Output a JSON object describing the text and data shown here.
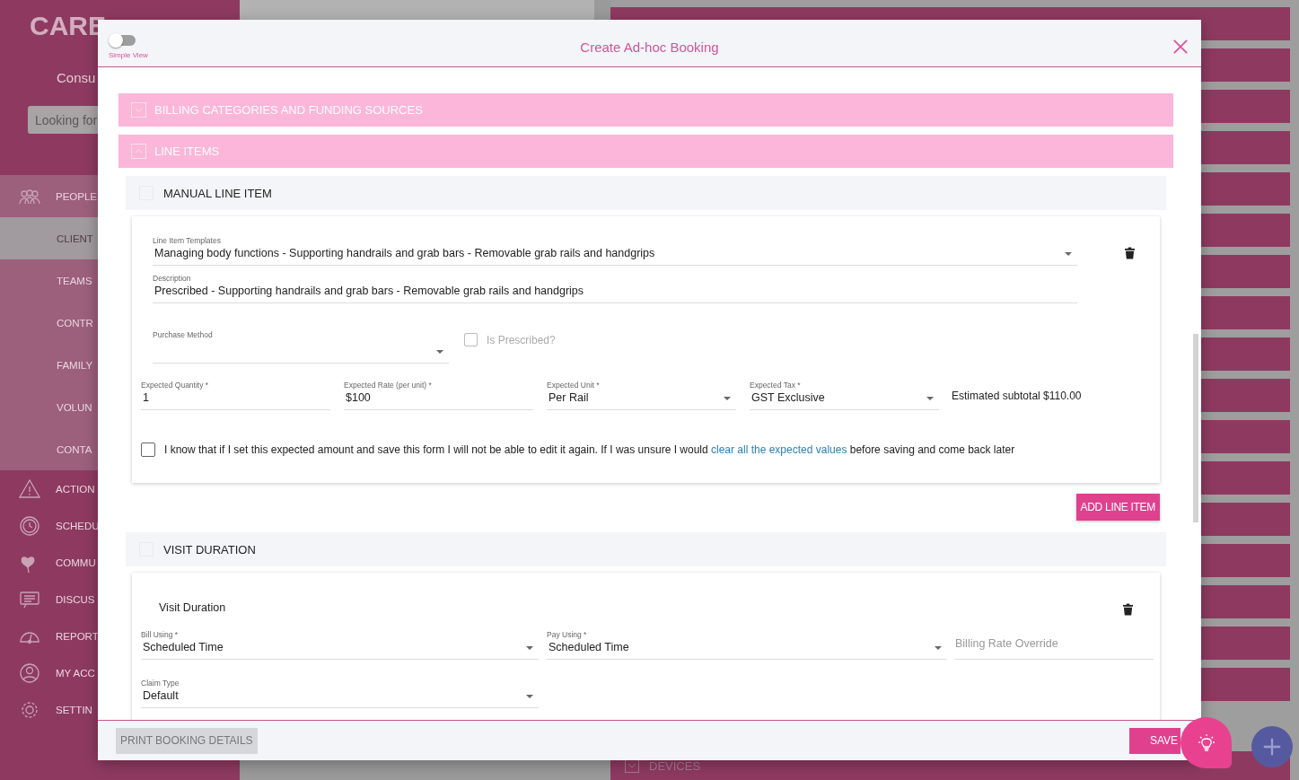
{
  "background": {
    "logo": "CARE",
    "subtitle": "Consu",
    "search": {
      "placeholder": "Looking for"
    },
    "nav": [
      {
        "label": "PEOPLE",
        "kind": "group",
        "selected": false
      },
      {
        "label": "CLIENT",
        "kind": "sub",
        "selected": true
      },
      {
        "label": "TEAMS",
        "kind": "sub",
        "selected": false
      },
      {
        "label": "CONTR",
        "kind": "sub",
        "selected": false
      },
      {
        "label": "FAMILY",
        "kind": "sub",
        "selected": false
      },
      {
        "label": "VOLUN",
        "kind": "sub",
        "selected": false
      },
      {
        "label": "CONTA",
        "kind": "sub",
        "selected": false
      },
      {
        "label": "ACTION",
        "kind": "item",
        "selected": false
      },
      {
        "label": "SCHEDU",
        "kind": "item",
        "selected": false
      },
      {
        "label": "COMMU",
        "kind": "item",
        "selected": false
      },
      {
        "label": "DISCUS",
        "kind": "item",
        "selected": false
      },
      {
        "label": "REPORT",
        "kind": "item",
        "selected": false
      },
      {
        "label": "MY ACC",
        "kind": "item",
        "selected": false
      },
      {
        "label": "SETTIN",
        "kind": "item",
        "selected": false
      }
    ],
    "list_last_row": "DEVICES"
  },
  "modal": {
    "simple_view": {
      "label": "Simple View",
      "on": false
    },
    "title": "Create Ad-hoc Booking",
    "sections": [
      {
        "title": "BILLING CATEGORIES AND FUNDING SOURCES",
        "expanded": false
      },
      {
        "title": "LINE ITEMS",
        "expanded": true
      }
    ],
    "manual_line_item": {
      "title": "MANUAL LINE ITEM",
      "template": {
        "label": "Line Item Templates",
        "value": "Managing body functions - Supporting handrails and grab bars - Removable grab rails and handgrips"
      },
      "description": {
        "label": "Description",
        "value": "Prescribed - Supporting handrails and grab bars - Removable grab rails and handgrips"
      },
      "purchase_method": {
        "label": "Purchase Method"
      },
      "is_prescribed": {
        "label": "Is Prescribed?",
        "checked": false,
        "disabled": true
      },
      "expected": [
        {
          "label": "Expected Quantity *",
          "value": "1",
          "kind": "text"
        },
        {
          "label": "Expected Rate (per unit) *",
          "value": "$100",
          "kind": "text"
        },
        {
          "label": "Expected Unit *",
          "value": "Per Rail",
          "kind": "select"
        },
        {
          "label": "Expected Tax *",
          "value": "GST Exclusive",
          "kind": "select"
        }
      ],
      "subtotal": "Estimated subtotal $110.00",
      "acknowledge": {
        "checked": false,
        "before": "I know that if I set this expected amount and save this form I will not be able to edit it again. If I was unsure I would",
        "link": "clear all the expected values",
        "after": "before saving and come back later"
      }
    },
    "add_button": "ADD LINE ITEM",
    "visit_duration": {
      "title": "VISIT DURATION",
      "card_title": "Visit Duration",
      "bill_using": {
        "label": "Bill Using *",
        "value": "Scheduled Time"
      },
      "pay_using": {
        "label": "Pay Using *",
        "value": "Scheduled Time"
      },
      "billing_rate_override": {
        "placeholder": "Billing Rate Override"
      },
      "claim_type": {
        "label": "Claim Type",
        "value": "Default"
      }
    },
    "footer": {
      "print": {
        "label": "PRINT BOOKING DETAILS",
        "disabled": true
      },
      "save": "SAVE"
    }
  }
}
